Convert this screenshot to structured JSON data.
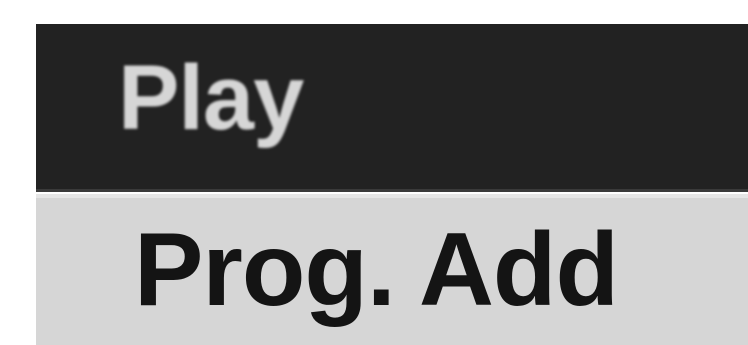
{
  "menu": {
    "header": {
      "label": "Play"
    },
    "items": [
      {
        "label": "Prog. Add",
        "selected": true
      }
    ]
  },
  "colors": {
    "header_background": "#222222",
    "header_text": "#d6d6d6",
    "item_background": "#d6d6d6",
    "item_text": "#141414"
  }
}
